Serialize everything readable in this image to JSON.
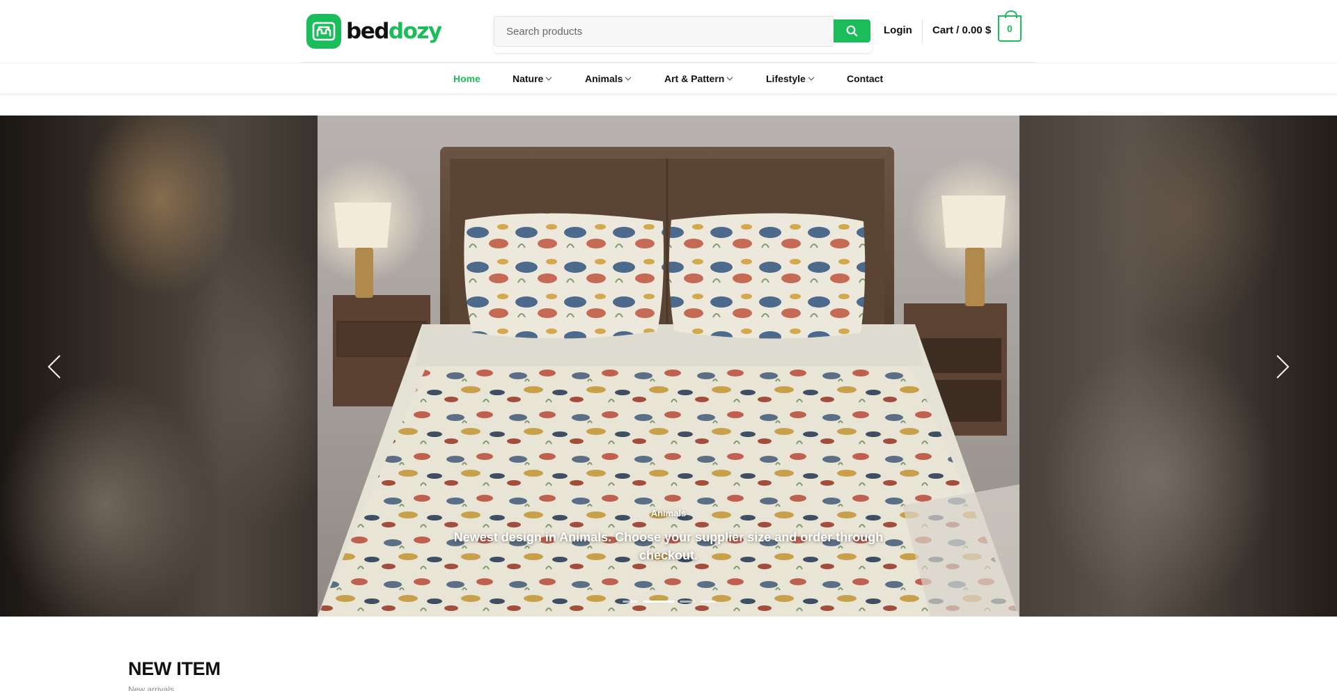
{
  "brand": {
    "name_part1": "bed",
    "name_part2": "dozy",
    "accent_color": "#1bbd5a",
    "logo_icon": "sofa-icon"
  },
  "header": {
    "search_placeholder": "Search products",
    "search_icon": "search-icon",
    "login_label": "Login",
    "cart_label": "Cart / 0.00 $",
    "cart_count": "0"
  },
  "nav": {
    "items": [
      {
        "label": "Home",
        "active": true,
        "has_dropdown": false
      },
      {
        "label": "Nature",
        "active": false,
        "has_dropdown": true
      },
      {
        "label": "Animals",
        "active": false,
        "has_dropdown": true
      },
      {
        "label": "Art & Pattern",
        "active": false,
        "has_dropdown": true
      },
      {
        "label": "Lifestyle",
        "active": false,
        "has_dropdown": true
      },
      {
        "label": "Contact",
        "active": false,
        "has_dropdown": false
      }
    ]
  },
  "slider": {
    "category": "Animals",
    "text": "Newest design in Animals. Choose your supplier size and order through checkout.",
    "prev_icon": "chevron-left-icon",
    "next_icon": "chevron-right-icon",
    "dot_count": 4,
    "active_dot": 2
  },
  "section": {
    "title": "NEW ITEM",
    "subtitle": "New arrivals"
  }
}
